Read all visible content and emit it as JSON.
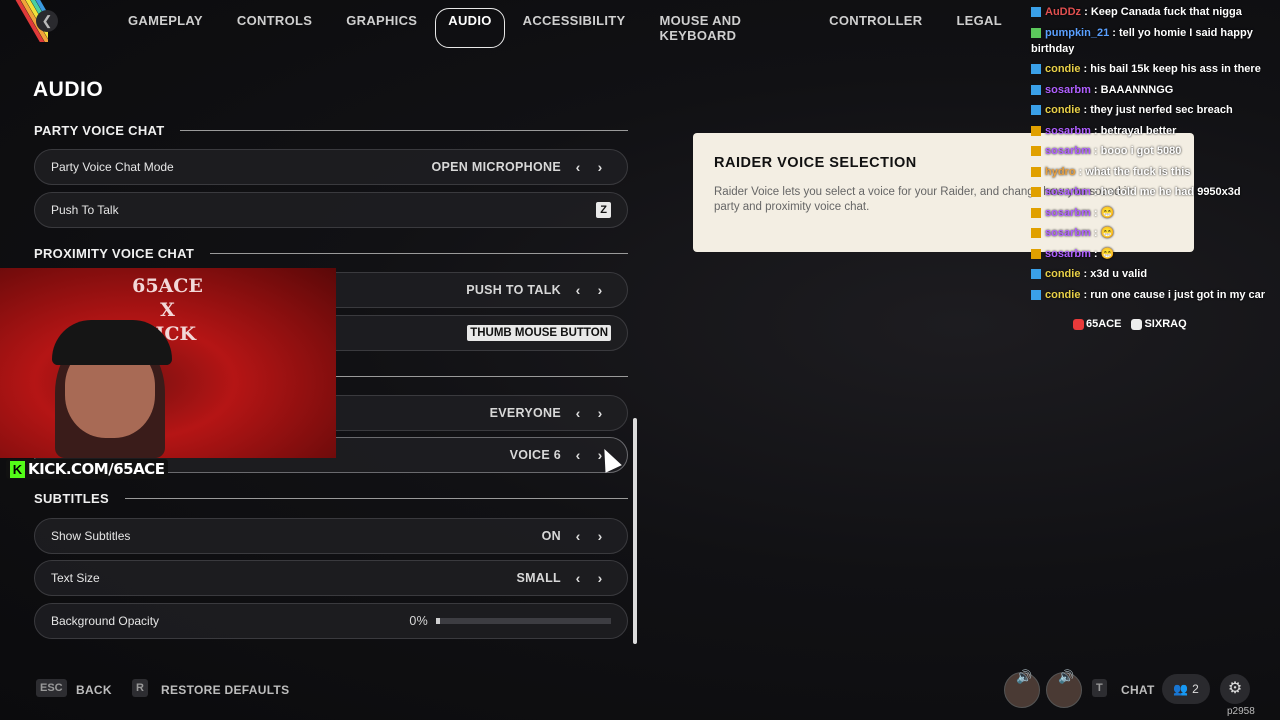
{
  "top_tabs": [
    "GAMEPLAY",
    "CONTROLS",
    "GRAPHICS",
    "AUDIO",
    "ACCESSIBILITY",
    "MOUSE AND KEYBOARD",
    "CONTROLLER",
    "LEGAL"
  ],
  "active_tab": "AUDIO",
  "page_title": "AUDIO",
  "sections": {
    "party": "PARTY VOICE CHAT",
    "proximity": "PROXIMITY VOICE CHAT",
    "subtitles": "SUBTITLES"
  },
  "rows": {
    "party_mode": {
      "label": "Party Voice Chat Mode",
      "value": "OPEN MICROPHONE"
    },
    "push_to_talk": {
      "label": "Push To Talk",
      "value": "Z"
    },
    "prox_mode": {
      "label": "",
      "value": "PUSH TO TALK"
    },
    "prox_key": {
      "label": "",
      "value": "THUMB MOUSE BUTTON"
    },
    "prox_hear": {
      "label": "",
      "value": "EVERYONE"
    },
    "raider_voice": {
      "label": "",
      "value": "VOICE 6"
    },
    "show_subtitles": {
      "label": "Show Subtitles",
      "value": "ON"
    },
    "text_size": {
      "label": "Text Size",
      "value": "SMALL"
    },
    "bg_opacity": {
      "label": "Background Opacity",
      "value": "0%",
      "level": 0.02
    }
  },
  "tooltip": {
    "title": "RAIDER VOICE SELECTION",
    "body": "Raider Voice lets you select a voice for your Raider, and change how you sound in party and proximity voice chat."
  },
  "webcam": {
    "logo_lines": [
      "65ACE",
      "X",
      "KICK"
    ],
    "badge": "KICK.COM/65ACE"
  },
  "chat": [
    {
      "user": "AuDDz",
      "text": "Keep Canada fuck that nigga",
      "color": "#e05050",
      "badge": "b"
    },
    {
      "user": "pumpkin_21",
      "text": "tell yo homie I said happy birthday",
      "color": "#5aa0ff",
      "badge": "g"
    },
    {
      "user": "condie",
      "text": "his bail 15k keep his ass in there",
      "color": "#e8d048",
      "badge": "b"
    },
    {
      "user": "sosarbm",
      "text": "BAAANNNGG",
      "color": "#b060ff",
      "badge": "b"
    },
    {
      "user": "condie",
      "text": "they just nerfed sec breach",
      "color": "#e8d048",
      "badge": "b"
    },
    {
      "user": "sosarbm",
      "text": "betrayal better",
      "color": "#b060ff",
      "badge": "y"
    },
    {
      "user": "sosarbm",
      "text": "booo i got 5080",
      "color": "#b060ff",
      "badge": "y"
    },
    {
      "user": "hydro",
      "text": "what the fuck is this",
      "color": "#e8a040",
      "badge": "y"
    },
    {
      "user": "sosarbm",
      "text": "he told me he had 9950x3d",
      "color": "#b060ff",
      "badge": "y"
    },
    {
      "user": "sosarbm",
      "text": "😁",
      "color": "#b060ff",
      "badge": "y"
    },
    {
      "user": "sosarbm",
      "text": "😁",
      "color": "#b060ff",
      "badge": "y"
    },
    {
      "user": "sosarbm",
      "text": "😁",
      "color": "#b060ff",
      "badge": "y"
    },
    {
      "user": "condie",
      "text": "x3d u valid",
      "color": "#e8d048",
      "badge": "b"
    },
    {
      "user": "condie",
      "text": "run one cause i just got in my car",
      "color": "#e8d048",
      "badge": "b"
    }
  ],
  "socials": [
    "65ACE",
    "SIXRAQ"
  ],
  "bottom": {
    "esc_key": "ESC",
    "back": "BACK",
    "r_key": "R",
    "restore": "RESTORE DEFAULTS",
    "t_key": "T",
    "chat": "CHAT",
    "party_count": "2",
    "build": "p2958"
  },
  "colors": {
    "accent": "#f3eee3",
    "kick": "#53fc18",
    "webcam_red": "#b51515"
  }
}
